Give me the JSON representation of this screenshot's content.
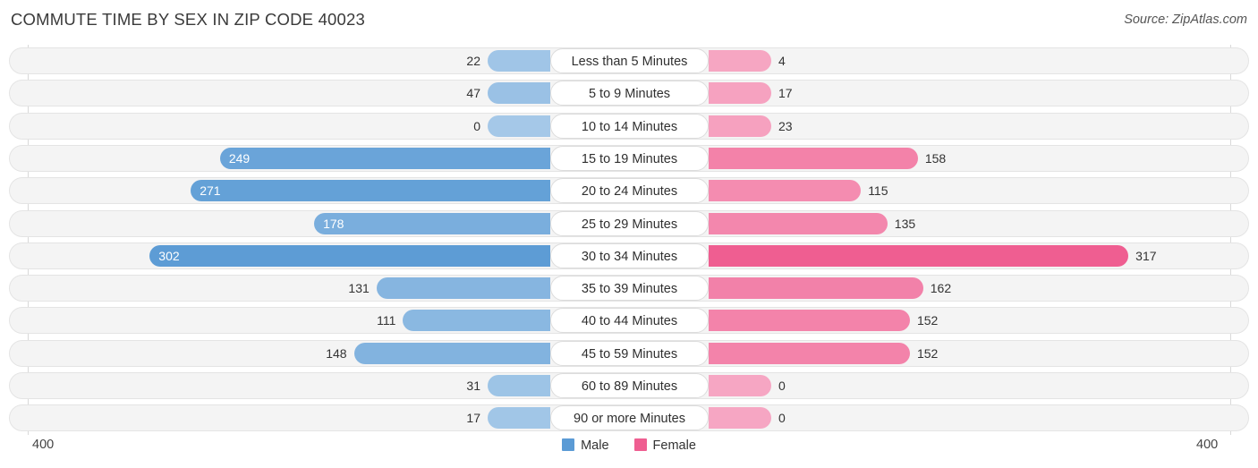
{
  "header": {
    "title": "COMMUTE TIME BY SEX IN ZIP CODE 40023",
    "source": "Source: ZipAtlas.com"
  },
  "axis": {
    "left_end": "400",
    "right_end": "400"
  },
  "legend": {
    "items": [
      {
        "label": "Male",
        "color": "#5b9bd5"
      },
      {
        "label": "Female",
        "color": "#ef5e91"
      }
    ]
  },
  "chart_data": {
    "type": "bar",
    "subtype": "diverging-bidirectional",
    "title": "COMMUTE TIME BY SEX IN ZIP CODE 40023",
    "xlabel": "",
    "ylabel": "",
    "source": "Source: ZipAtlas.com",
    "axis_max": 400,
    "xlim": [
      400,
      400
    ],
    "grid": false,
    "legend_position": "bottom-center",
    "categories": [
      "Less than 5 Minutes",
      "5 to 9 Minutes",
      "10 to 14 Minutes",
      "15 to 19 Minutes",
      "20 to 24 Minutes",
      "25 to 29 Minutes",
      "30 to 34 Minutes",
      "35 to 39 Minutes",
      "40 to 44 Minutes",
      "45 to 59 Minutes",
      "60 to 89 Minutes",
      "90 or more Minutes"
    ],
    "series": [
      {
        "name": "Male",
        "color": "#5b9bd5",
        "direction": "left",
        "values": [
          22,
          47,
          0,
          249,
          271,
          178,
          302,
          131,
          111,
          148,
          31,
          17
        ]
      },
      {
        "name": "Female",
        "color": "#ef5e91",
        "direction": "right",
        "values": [
          4,
          17,
          23,
          158,
          115,
          135,
          317,
          162,
          152,
          152,
          0,
          0
        ]
      }
    ]
  },
  "rows": [
    {
      "label": "Less than 5 Minutes",
      "male": "22",
      "female": "4"
    },
    {
      "label": "5 to 9 Minutes",
      "male": "47",
      "female": "17"
    },
    {
      "label": "10 to 14 Minutes",
      "male": "0",
      "female": "23"
    },
    {
      "label": "15 to 19 Minutes",
      "male": "249",
      "female": "158"
    },
    {
      "label": "20 to 24 Minutes",
      "male": "271",
      "female": "115"
    },
    {
      "label": "25 to 29 Minutes",
      "male": "178",
      "female": "135"
    },
    {
      "label": "30 to 34 Minutes",
      "male": "302",
      "female": "317"
    },
    {
      "label": "35 to 39 Minutes",
      "male": "131",
      "female": "162"
    },
    {
      "label": "40 to 44 Minutes",
      "male": "111",
      "female": "152"
    },
    {
      "label": "45 to 59 Minutes",
      "male": "148",
      "female": "152"
    },
    {
      "label": "60 to 89 Minutes",
      "male": "31",
      "female": "0"
    },
    {
      "label": "90 or more Minutes",
      "male": "17",
      "female": "0"
    }
  ]
}
